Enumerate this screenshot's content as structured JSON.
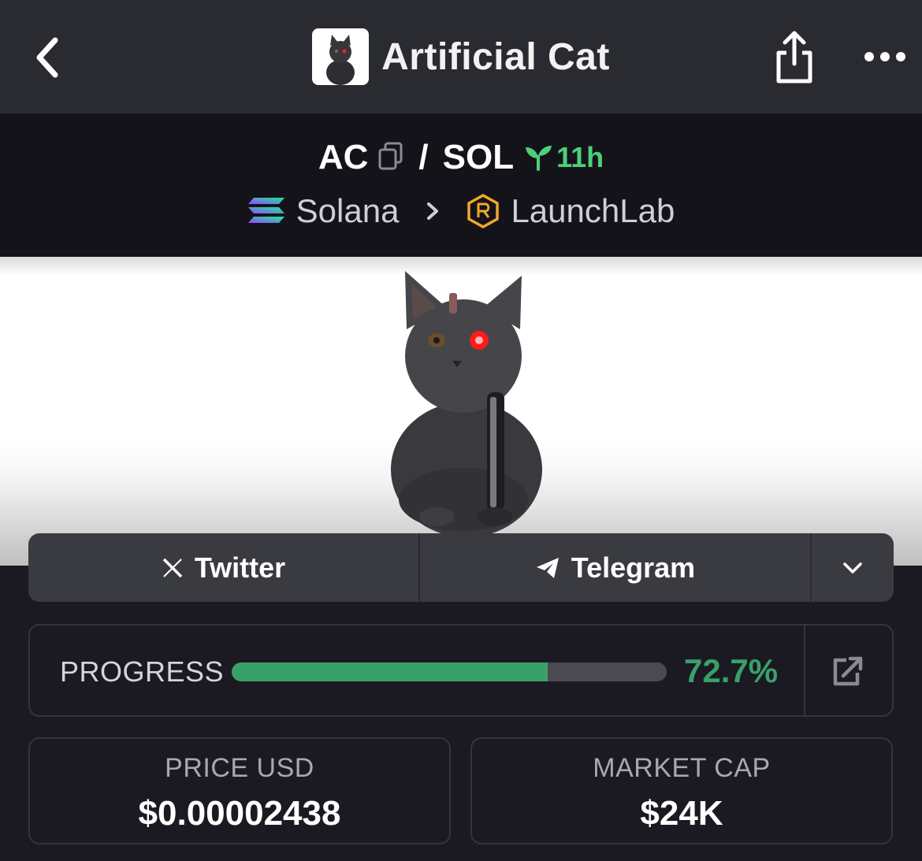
{
  "header": {
    "title": "Artificial Cat",
    "back_icon": "chevron-left-icon",
    "share_icon": "share-icon",
    "more_icon": "more-horizontal-icon"
  },
  "pair": {
    "base": "AC",
    "separator": "/",
    "quote": "SOL",
    "age": "11h",
    "chain": "Solana",
    "dex": "LaunchLab"
  },
  "social": {
    "twitter_label": "Twitter",
    "telegram_label": "Telegram"
  },
  "progress": {
    "label": "PROGRESS",
    "value": "72.7%",
    "percent": 72.7
  },
  "stats": {
    "price_label": "PRICE USD",
    "price_value": "$0.00002438",
    "mcap_label": "MARKET CAP",
    "mcap_value": "$24K"
  },
  "colors": {
    "accent_green": "#3aa06a",
    "age_green": "#4cd17a",
    "background": "#1b1a22",
    "header_bg": "#2a2a31"
  }
}
